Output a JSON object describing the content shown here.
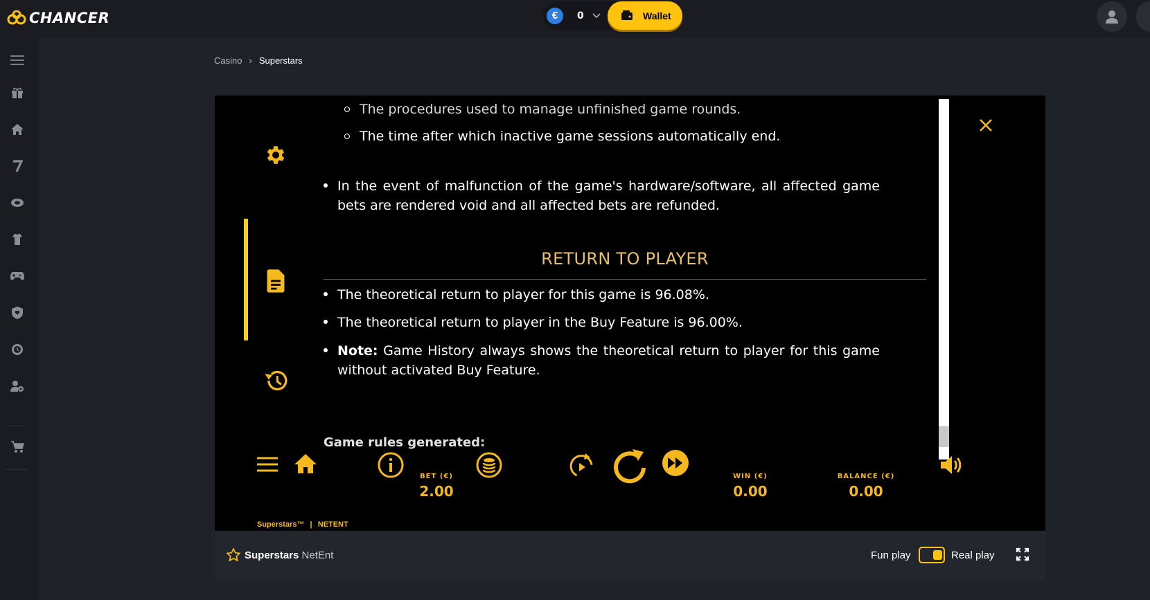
{
  "brand": {
    "name": "CHANCER"
  },
  "header": {
    "balance": "0",
    "currency_symbol": "€",
    "wallet_label": "Wallet"
  },
  "breadcrumb": {
    "root": "Casino",
    "current": "Superstars"
  },
  "rules": {
    "sub_items": [
      "The procedures used to manage unfinished game rounds.",
      "The time after which inactive game sessions automatically end."
    ],
    "malfunction": "In the event of malfunction of the game's hardware/software, all affected game bets are rendered void and all affected bets are refunded.",
    "rtp_title": "RETURN TO PLAYER",
    "rtp_items": [
      "The theoretical return to player for this game is 96.08%.",
      "The theoretical return to player in the Buy Feature is 96.00%."
    ],
    "note_label": "Note:",
    "note_text": "Game History always shows the theoretical return to player for this game without activated Buy Feature.",
    "generated": "Game rules generated:"
  },
  "controls": {
    "bet_label": "BET (€)",
    "bet_value": "2.00",
    "win_label": "WIN (€)",
    "win_value": "0.00",
    "balance_label": "BALANCE (€)",
    "balance_value": "0.00",
    "game_brand": "Superstars™",
    "provider_brand": "NETENT"
  },
  "infobar": {
    "game_name": "Superstars",
    "provider": "NetEnt",
    "fun_play": "Fun play",
    "real_play": "Real play"
  },
  "colors": {
    "accent": "#ffc20e",
    "game_gold": "#f5b81e",
    "rtp_title": "#e9c06a"
  }
}
